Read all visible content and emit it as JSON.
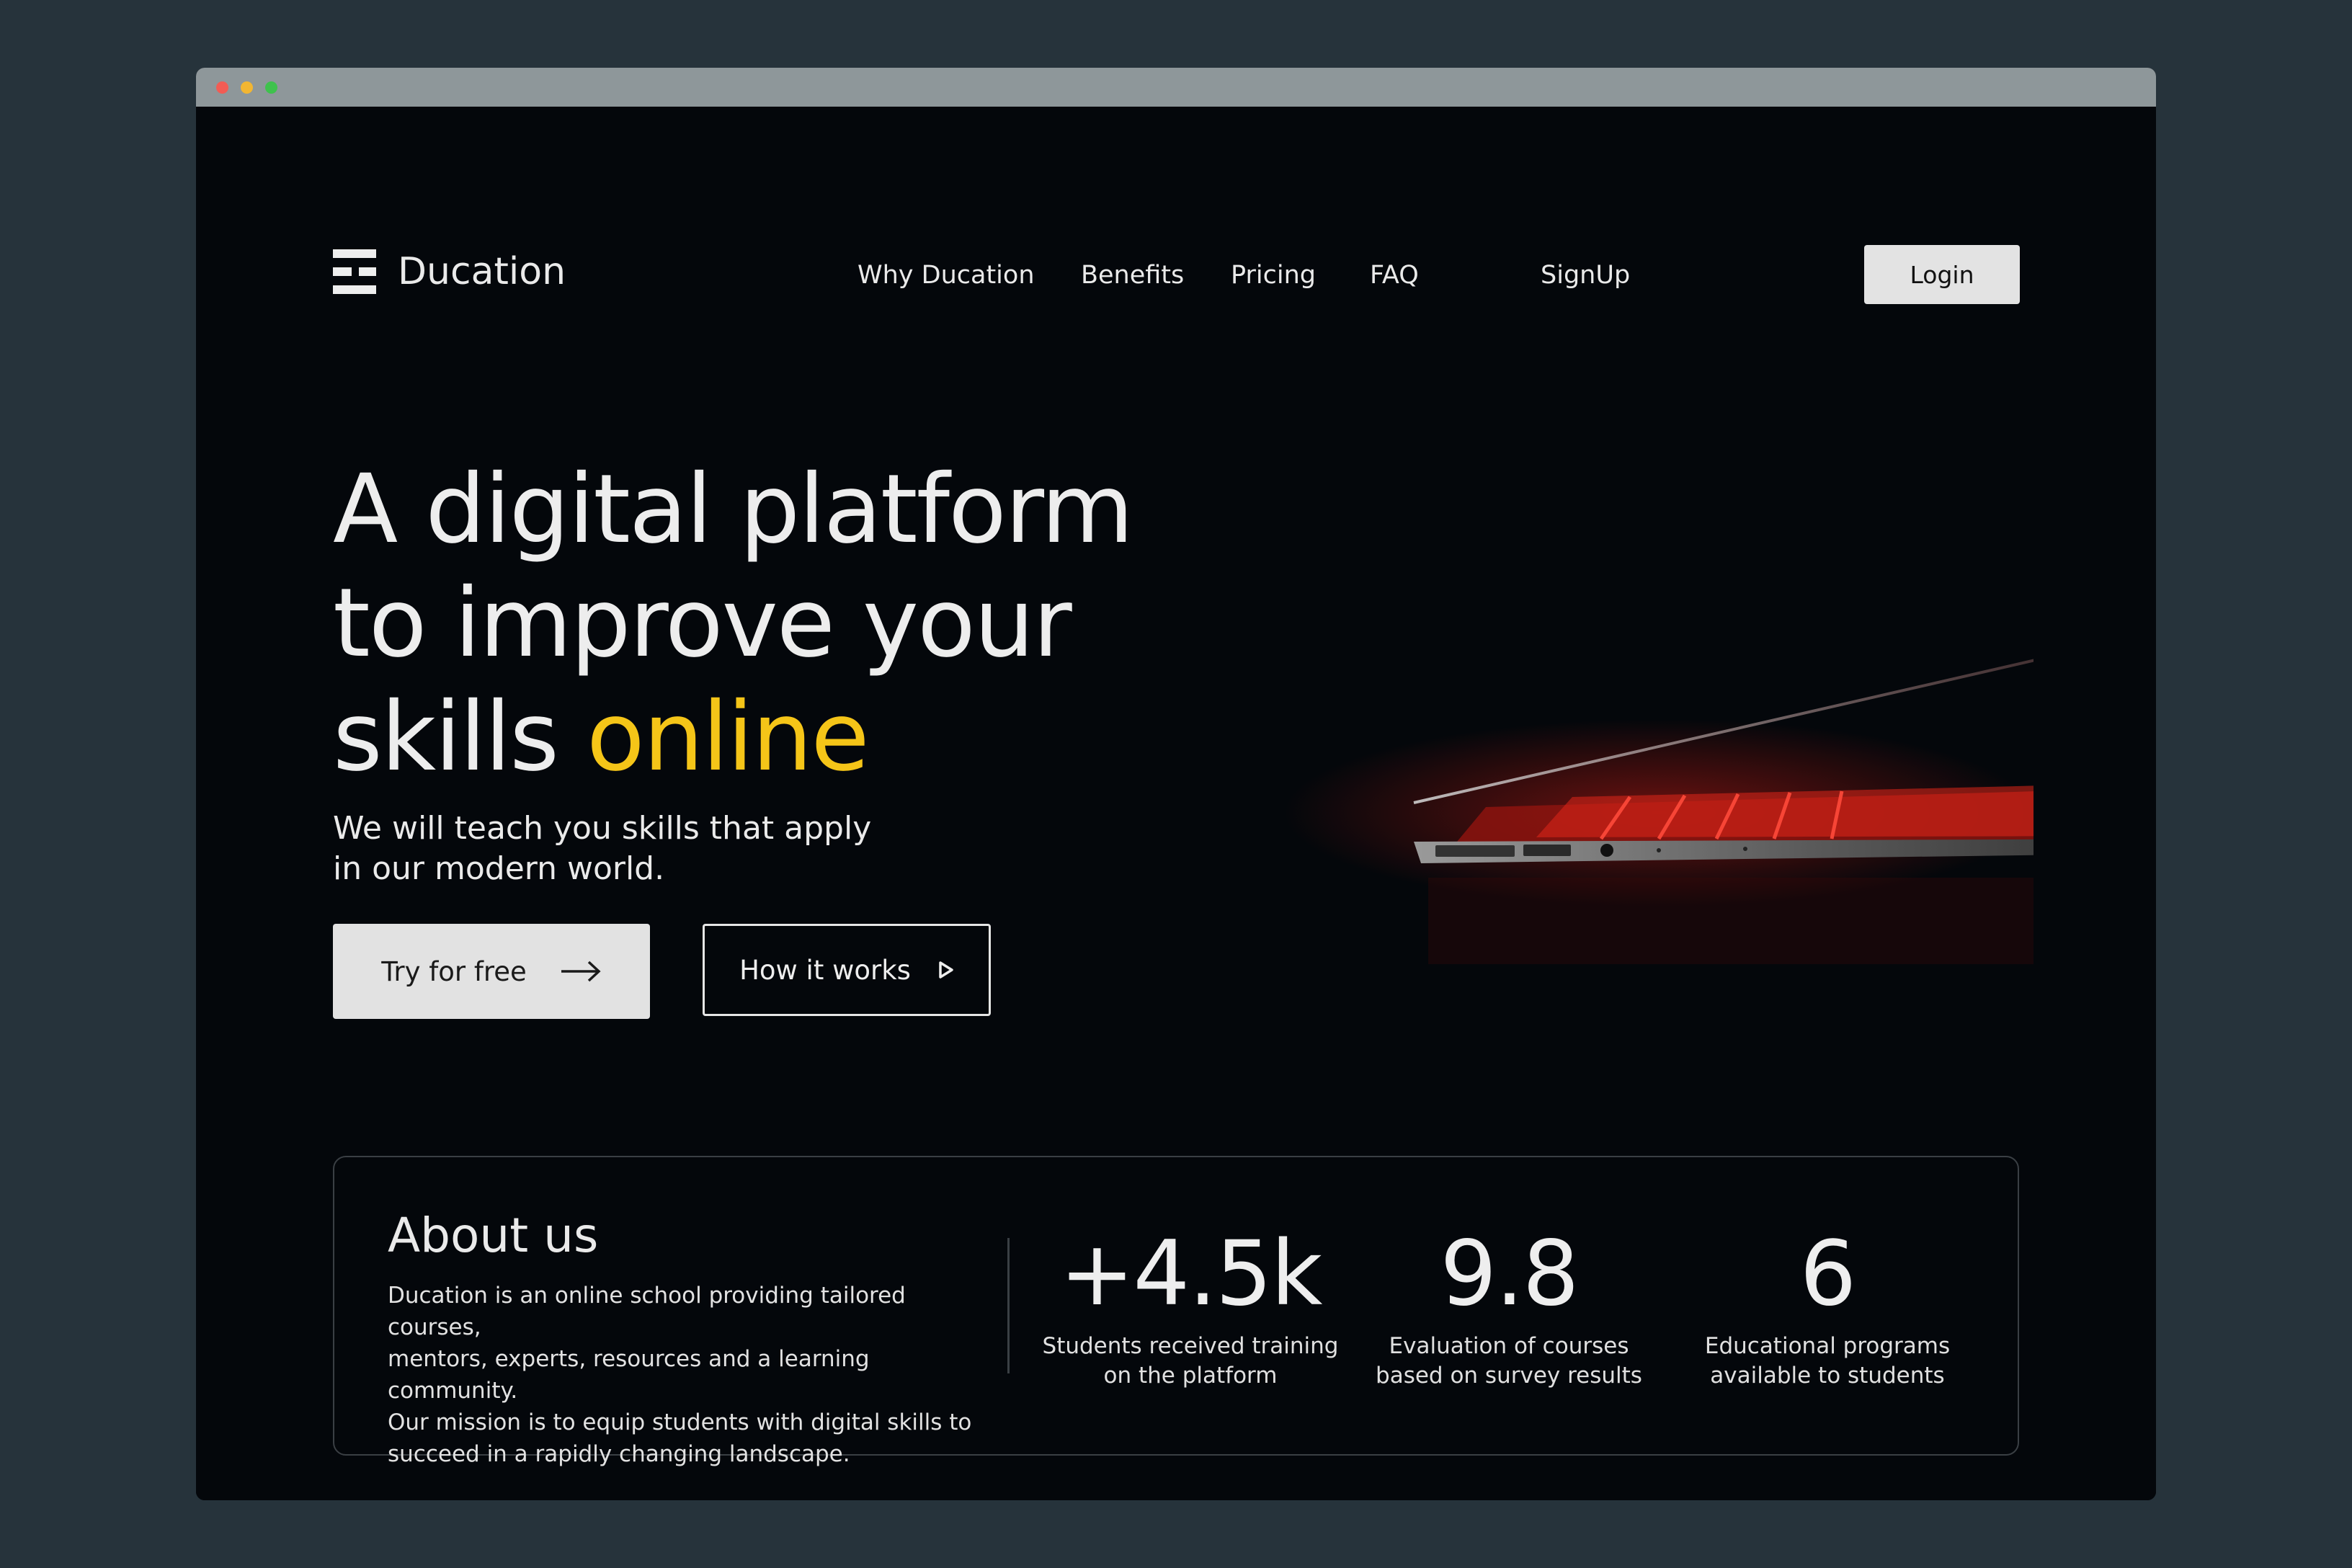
{
  "brand": {
    "name": "Ducation"
  },
  "nav": {
    "items": [
      "Why Ducation",
      "Benefits",
      "Pricing",
      "FAQ"
    ],
    "signup": "SignUp",
    "login": "Login"
  },
  "hero": {
    "headline_line1": "A digital platform",
    "headline_line2": "to improve your",
    "headline_line3_prefix": "skills ",
    "headline_highlight": "online",
    "subtitle_line1": "We will teach you skills that apply",
    "subtitle_line2": "in our modern world.",
    "cta_primary": "Try for free",
    "cta_secondary": "How it works"
  },
  "about": {
    "title": "About us",
    "text_lines": [
      "Ducation is an online school providing tailored courses,",
      "mentors, experts, resources and a learning community.",
      "Our mission is to equip students with digital skills to",
      "succeed in a rapidly changing landscape."
    ]
  },
  "stats": [
    {
      "value": "+4.5k",
      "label_line1": "Students received training",
      "label_line2": "on the platform"
    },
    {
      "value": "9.8",
      "label_line1": "Evaluation of courses",
      "label_line2": "based on survey results"
    },
    {
      "value": "6",
      "label_line1": "Educational programs",
      "label_line2": "available to students"
    }
  ],
  "colors": {
    "background": "#04070b",
    "accent": "#f5c518",
    "button_light": "#e2e2e2",
    "laptop_glow": "#d8261c"
  },
  "icons": {
    "logo": "ducation-logo-icon",
    "try_arrow": "arrow-right-icon",
    "how_play": "play-triangle-icon"
  }
}
